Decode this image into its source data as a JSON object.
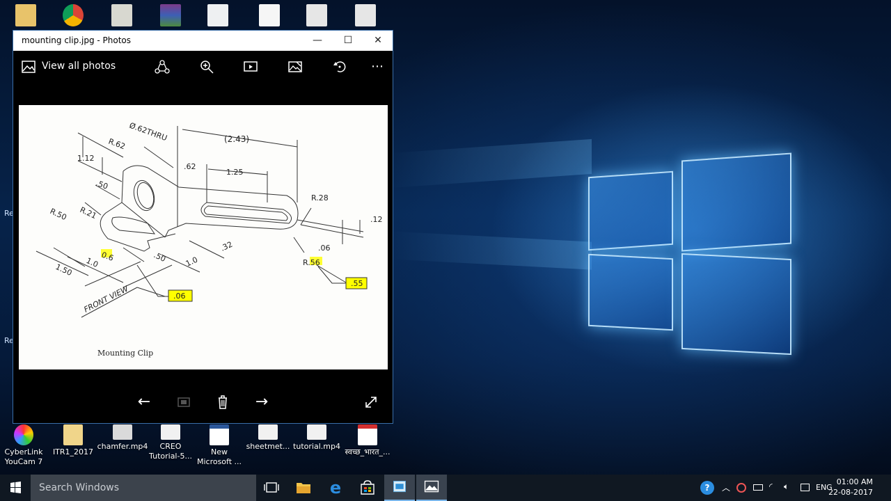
{
  "window": {
    "title": "mounting clip.jpg - Photos",
    "minimize": "—",
    "maximize": "☐",
    "close": "✕"
  },
  "app_bar": {
    "view_all": "View all photos"
  },
  "drawing": {
    "caption": "Mounting Clip",
    "labels": {
      "thru": "Ø.62THRU",
      "len": "(2.43)",
      "r62": "R.62",
      "d112": "1.12",
      "d62": ".62",
      "d125": "1.25",
      "d50a": ".50",
      "r28": "R.28",
      "r50": "R.50",
      "r21": "R.21",
      "d12": ".12",
      "d06a": ".06",
      "d32": ".32",
      "r56": "R.56",
      "d06b": "0.6",
      "d50b": ".50",
      "d10a": "1.0",
      "d10b": "1.0",
      "d150": "1.50",
      "front": "FRONT VIEW",
      "callout1": ".06",
      "callout2": ".55"
    }
  },
  "desktop_icons": [
    {
      "label": "CyberLink YouCam 7"
    },
    {
      "label": "ITR1_2017"
    },
    {
      "label": "chamfer.mp4"
    },
    {
      "label": "CREO Tutorial-5..."
    },
    {
      "label": "New Microsoft ..."
    },
    {
      "label": "sheetmet..."
    },
    {
      "label": "tutorial.mp4"
    },
    {
      "label": "स्वच्छ_भारत_..."
    }
  ],
  "taskbar": {
    "search_placeholder": "Search Windows",
    "language": "ENG",
    "time": "01:00 AM",
    "date": "22-08-2017"
  },
  "colors": {
    "highlight": "#ffff00",
    "taskbar": "#101822",
    "accent": "#79b5ea"
  }
}
